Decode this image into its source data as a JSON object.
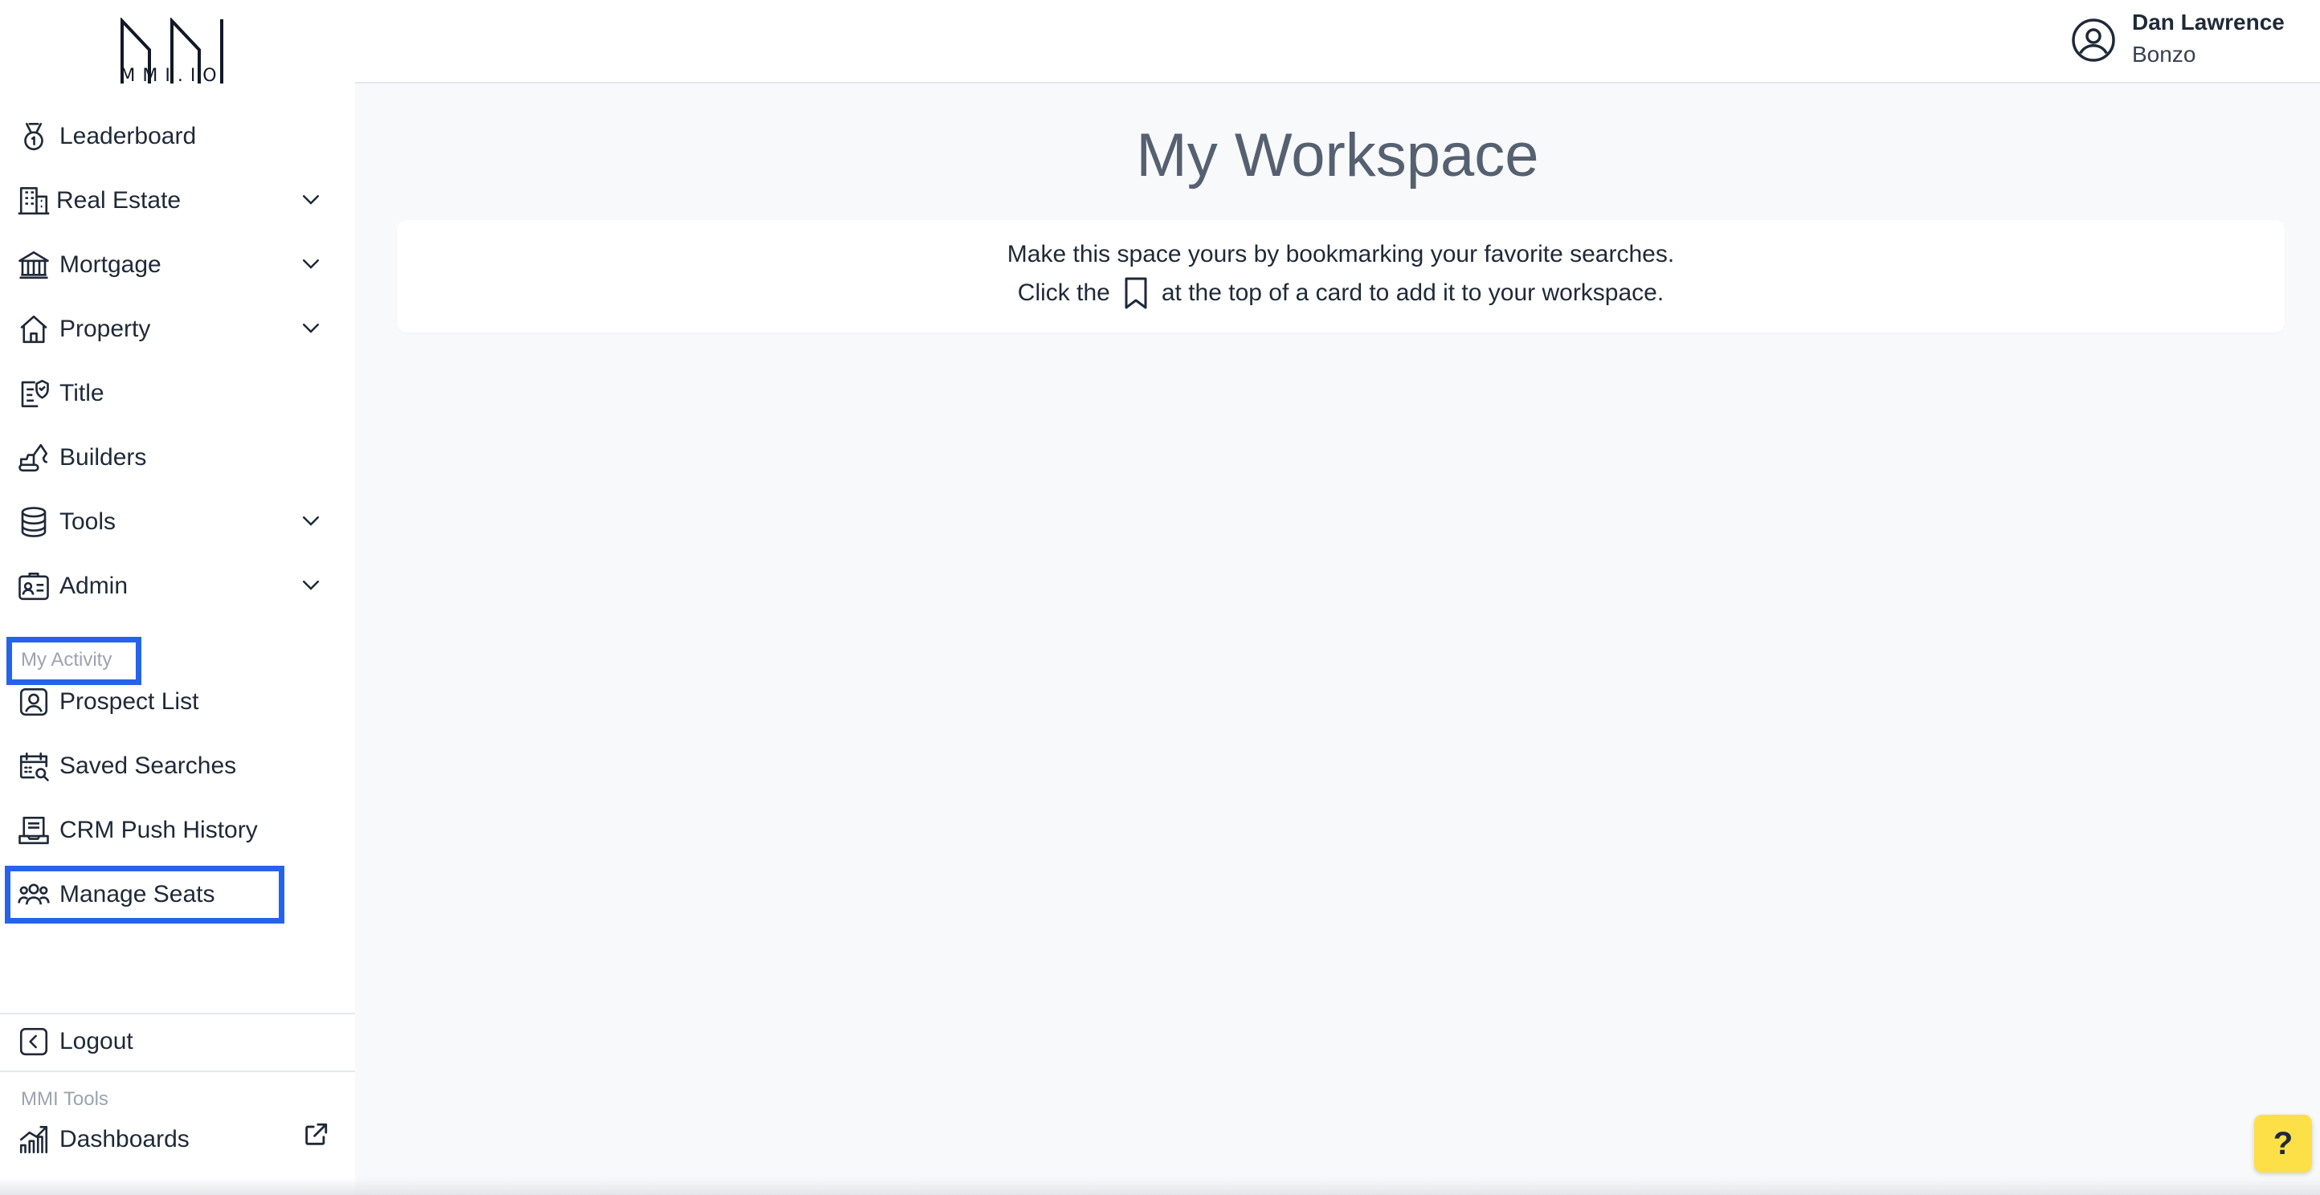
{
  "logo": {
    "text": "MMI.IO"
  },
  "sidebar": {
    "items": [
      {
        "label": "Leaderboard",
        "icon": "medal-icon"
      },
      {
        "label": "Real Estate",
        "icon": "building-icon"
      },
      {
        "label": "Mortgage",
        "icon": "bank-icon"
      },
      {
        "label": "Property",
        "icon": "home-icon"
      },
      {
        "label": "Title",
        "icon": "title-document-icon"
      },
      {
        "label": "Builders",
        "icon": "excavator-icon"
      },
      {
        "label": "Tools",
        "icon": "database-icon"
      },
      {
        "label": "Admin",
        "icon": "id-card-icon"
      }
    ],
    "activity_section": "My Activity",
    "activity_items": [
      {
        "label": "Prospect List",
        "icon": "user-square-icon"
      },
      {
        "label": "Saved Searches",
        "icon": "calendar-search-icon"
      },
      {
        "label": "CRM Push History",
        "icon": "inbox-icon"
      },
      {
        "label": "Manage Seats",
        "icon": "users-icon"
      }
    ],
    "logout_label": "Logout",
    "tools_section": "MMI Tools",
    "dashboards_label": "Dashboards"
  },
  "header": {
    "user_name": "Dan Lawrence",
    "user_org": "Bonzo"
  },
  "main": {
    "title": "My Workspace",
    "message_line1": "Make this space yours by bookmarking your favorite searches.",
    "message_prefix": "Click the",
    "message_suffix": "at the top of a card to add it to your workspace."
  },
  "help": {
    "label": "?"
  },
  "colors": {
    "highlight": "#2563eb",
    "help_button": "#fde047",
    "title": "#556070"
  }
}
